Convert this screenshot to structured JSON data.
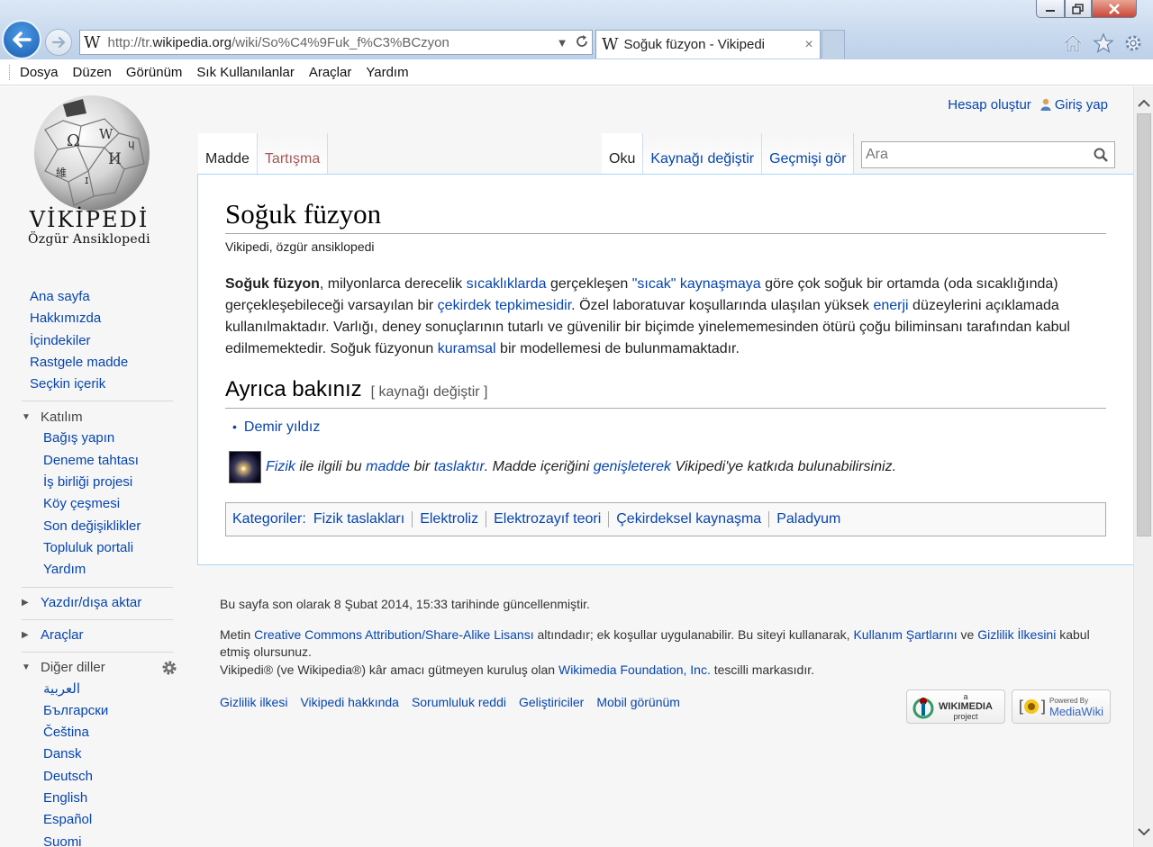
{
  "browser": {
    "url_prefix": "http://tr.",
    "url_domain": "wikipedia.org",
    "url_path": "/wiki/So%C4%9Fuk_f%C3%BCzyon",
    "tab_title": "Soğuk füzyon - Vikipedi",
    "tab_close": "×",
    "menu": [
      "Dosya",
      "Düzen",
      "Görünüm",
      "Sık Kullanılanlar",
      "Araçlar",
      "Yardım"
    ]
  },
  "personal": {
    "create_account": "Hesap oluştur",
    "login": "Giriş yap"
  },
  "logo": {
    "title": "VİKİPEDİ",
    "tagline": "Özgür Ansiklopedi"
  },
  "nav": {
    "main": [
      "Ana sayfa",
      "Hakkımızda",
      "İçindekiler",
      "Rastgele madde",
      "Seçkin içerik"
    ],
    "participation_head": "Katılım",
    "participation": [
      "Bağış yapın",
      "Deneme tahtası",
      "İş birliği projesi",
      "Köy çeşmesi",
      "Son değişiklikler",
      "Topluluk portali",
      "Yardım"
    ],
    "print_head": "Yazdır/dışa aktar",
    "tools_head": "Araçlar",
    "languages_head": "Diğer diller",
    "languages": [
      "العربية",
      "Български",
      "Čeština",
      "Dansk",
      "Deutsch",
      "English",
      "Español",
      "Suomi"
    ]
  },
  "tabs": {
    "article": "Madde",
    "talk": "Tartışma",
    "read": "Oku",
    "edit_source": "Kaynağı değiştir",
    "history": "Geçmişi gör"
  },
  "search": {
    "placeholder": "Ara"
  },
  "article": {
    "title": "Soğuk füzyon",
    "site_sub": "Vikipedi, özgür ansiklopedi",
    "p": {
      "bold": "Soğuk füzyon",
      "t1": ", milyonlarca derecelik ",
      "l1": "sıcaklıklarda",
      "t2": " gerçekleşen ",
      "l2": "\"sıcak\" kaynaşmaya",
      "t3": " göre çok soğuk bir ortamda (oda sıcaklığında) gerçekleşebileceği varsayılan bir ",
      "l3": "çekirdek tepkimesidir",
      "t4": ". Özel laboratuvar koşullarında ulaşılan yüksek ",
      "l4": "enerji",
      "t5": " düzeylerini açıklamada kullanılmaktadır. Varlığı, deney sonuçlarının tutarlı ve güvenilir bir biçimde yinelememesinden ötürü çoğu biliminsanı tarafından kabul edilmemektedir. Soğuk füzyonun ",
      "l5": "kuramsal",
      "t6": " bir modellemesi de bulunmamaktadır."
    },
    "see_also": {
      "heading": "Ayrıca bakınız",
      "edit": "[ kaynağı değiştir ]",
      "items": [
        "Demir yıldız"
      ]
    },
    "stub": {
      "l1": "Fizik",
      "t1": " ile ilgili bu ",
      "l2": "madde",
      "t2": " bir ",
      "l3": "taslaktır",
      "t3": ". Madde içeriğini ",
      "l4": "genişleterek",
      "t4": " Vikipedi'ye katkıda bulunabilirsiniz."
    },
    "categories": {
      "label": "Kategoriler:",
      "items": [
        "Fizik taslakları",
        "Elektroliz",
        "Elektrozayıf teori",
        "Çekirdeksel kaynaşma",
        "Paladyum"
      ]
    }
  },
  "footer": {
    "last_mod": "Bu sayfa son olarak 8 Şubat 2014, 15:33 tarihinde güncellenmiştir.",
    "lic_t1": "Metin ",
    "lic_l1": "Creative Commons Attribution/Share-Alike Lisansı",
    "lic_t2": " altındadır; ek koşullar uygulanabilir. Bu siteyi kullanarak, ",
    "lic_l2": "Kullanım Şartlarını",
    "lic_t3": " ve ",
    "lic_l3": "Gizlilik İlkesini",
    "lic_t4": " kabul etmiş olursunuz.",
    "tm_t1": "Vikipedi® (ve Wikipedia®) kâr amacı gütmeyen kuruluş olan ",
    "tm_l1": "Wikimedia Foundation, Inc.",
    "tm_t2": " tescilli markasıdır.",
    "places": [
      "Gizlilik ilkesi",
      "Vikipedi hakkında",
      "Sorumluluk reddi",
      "Geliştiriciler",
      "Mobil görünüm"
    ],
    "badge_wikimedia_small": "a",
    "badge_wikimedia": "WIKIMEDIA",
    "badge_wikimedia_sub": "project",
    "badge_mediawiki_small": "Powered By",
    "badge_mediawiki": "MediaWiki"
  }
}
